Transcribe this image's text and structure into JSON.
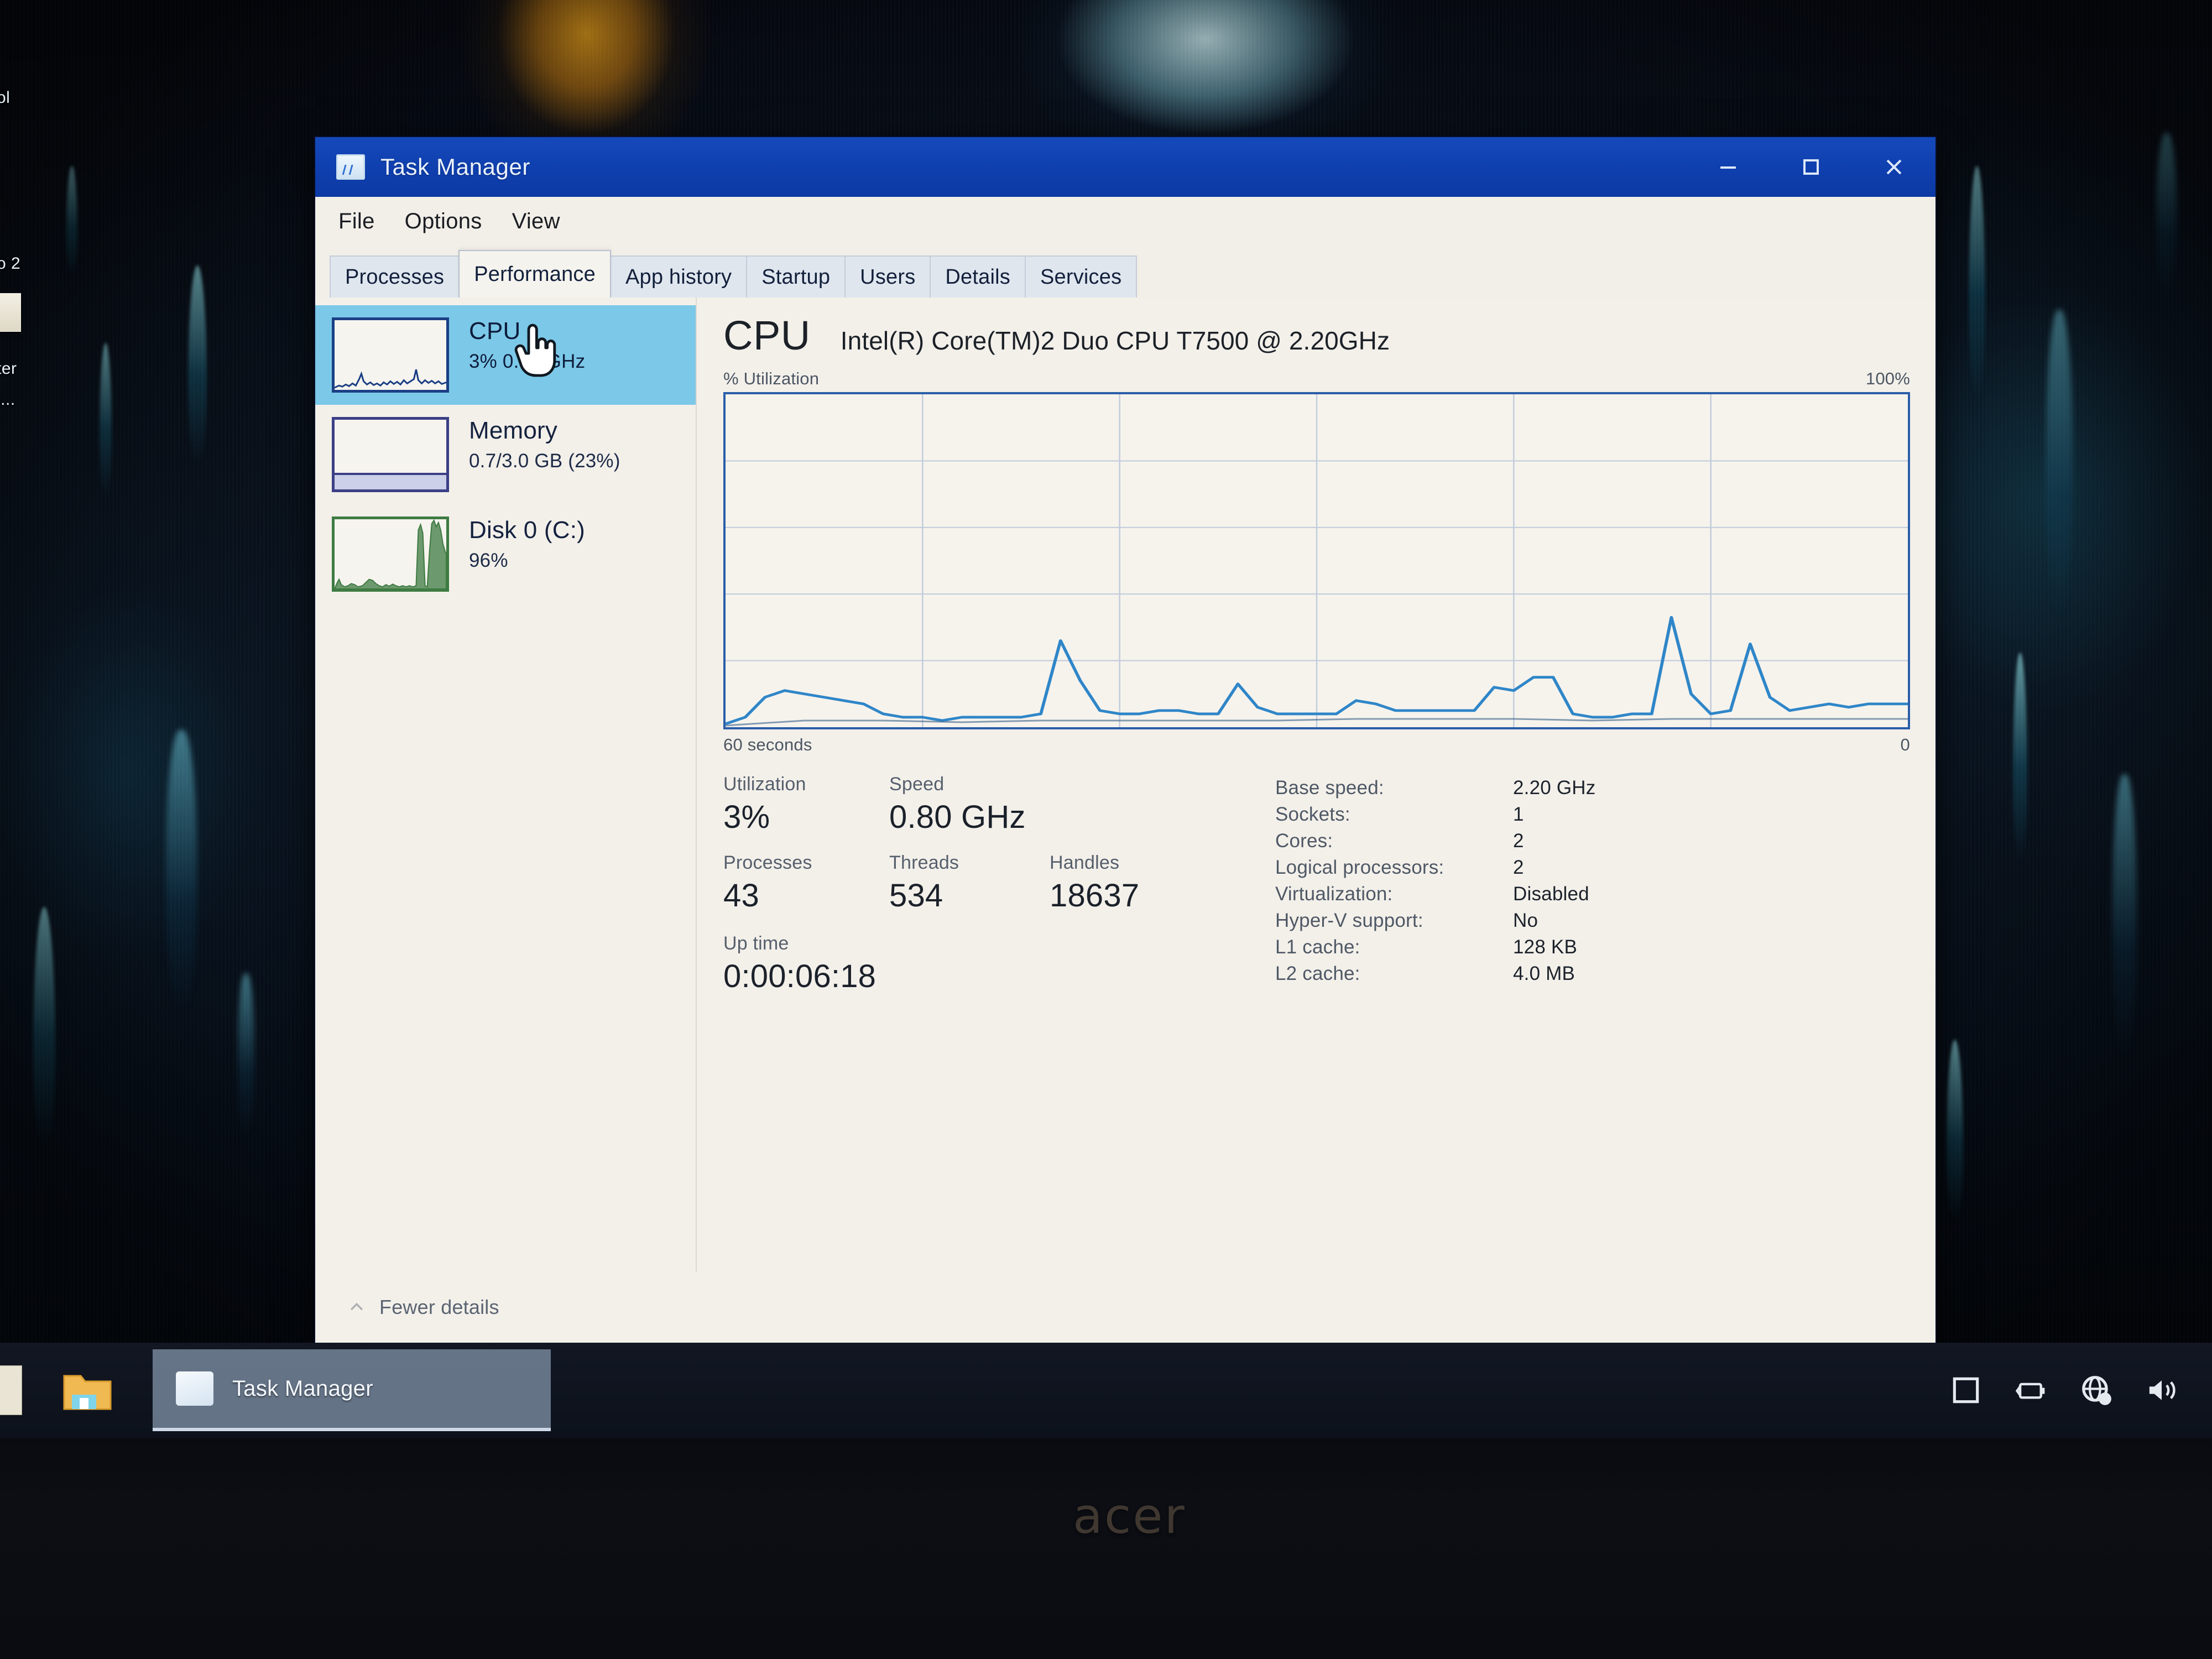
{
  "window": {
    "title": "Task Manager",
    "icon": "task-manager-icon",
    "controls": {
      "minimize": "minimize-icon",
      "maximize": "maximize-icon",
      "close": "close-icon"
    }
  },
  "menu": {
    "items": [
      "File",
      "Options",
      "View"
    ]
  },
  "tabs": [
    {
      "label": "Processes",
      "active": false
    },
    {
      "label": "Performance",
      "active": true
    },
    {
      "label": "App history",
      "active": false
    },
    {
      "label": "Startup",
      "active": false
    },
    {
      "label": "Users",
      "active": false
    },
    {
      "label": "Details",
      "active": false
    },
    {
      "label": "Services",
      "active": false
    }
  ],
  "sidebar": {
    "items": [
      {
        "title": "CPU",
        "sub": "3%  0.80 GHz",
        "selected": true,
        "accent": "#1b3f85"
      },
      {
        "title": "Memory",
        "sub": "0.7/3.0 GB (23%)",
        "selected": false,
        "accent": "#3b3f86"
      },
      {
        "title": "Disk 0 (C:)",
        "sub": "96%",
        "selected": false,
        "accent": "#3e7b42"
      }
    ]
  },
  "pane": {
    "title": "CPU",
    "model": "Intel(R) Core(TM)2 Duo CPU T7500 @ 2.20GHz",
    "axis_top_left": "% Utilization",
    "axis_top_right": "100%",
    "axis_bottom_left": "60 seconds",
    "axis_bottom_right": "0"
  },
  "stats": {
    "utilization_label": "Utilization",
    "utilization_value": "3%",
    "speed_label": "Speed",
    "speed_value": "0.80 GHz",
    "processes_label": "Processes",
    "processes_value": "43",
    "threads_label": "Threads",
    "threads_value": "534",
    "handles_label": "Handles",
    "handles_value": "18637",
    "uptime_label": "Up time",
    "uptime_value": "0:00:06:18"
  },
  "specs": [
    {
      "key": "Base speed:",
      "value": "2.20 GHz"
    },
    {
      "key": "Sockets:",
      "value": "1"
    },
    {
      "key": "Cores:",
      "value": "2"
    },
    {
      "key": "Logical processors:",
      "value": "2"
    },
    {
      "key": "Virtualization:",
      "value": "Disabled"
    },
    {
      "key": "Hyper-V support:",
      "value": "No"
    },
    {
      "key": "L1 cache:",
      "value": "128 KB"
    },
    {
      "key": "L2 cache:",
      "value": "4.0 MB"
    }
  ],
  "footer": {
    "fewer_details": "Fewer details",
    "chevron": "chevron-up-icon"
  },
  "taskbar": {
    "explorer_label": "file-explorer-icon",
    "task_button": "Task Manager",
    "tray": [
      "action-center-icon",
      "battery-icon",
      "network-globe-icon",
      "volume-icon"
    ]
  },
  "desktop": {
    "icon_labels": [
      "ol",
      "o 2",
      "ter",
      "l..."
    ]
  },
  "hardware": {
    "brand": "acer"
  },
  "colors": {
    "titlebar": "#0f3fae",
    "selection": "#7cc8e8",
    "cpu_line": "#2a7fc4",
    "cpu_border": "#2a5da8",
    "disk_line": "#3e7b42",
    "window_bg": "#f2efe9"
  },
  "chart_data": {
    "type": "line",
    "title": "% Utilization",
    "xlabel": "60 seconds",
    "ylabel": "% Utilization",
    "ylim": [
      0,
      100
    ],
    "xlim": [
      60,
      0
    ],
    "grid": true,
    "grid_cols": 6,
    "grid_rows": 5,
    "legend": "none",
    "series": [
      {
        "name": "CPU utilization",
        "values": [
          1,
          3,
          9,
          11,
          10,
          9,
          8,
          7,
          4,
          3,
          3,
          2,
          3,
          3,
          3,
          3,
          4,
          26,
          14,
          5,
          4,
          4,
          5,
          5,
          4,
          4,
          13,
          6,
          4,
          4,
          4,
          4,
          8,
          7,
          5,
          5,
          5,
          5,
          5,
          12,
          11,
          15,
          15,
          4,
          3,
          3,
          4,
          4,
          33,
          10,
          4,
          5,
          25,
          9,
          5,
          6,
          7,
          6,
          7,
          7
        ]
      }
    ]
  }
}
